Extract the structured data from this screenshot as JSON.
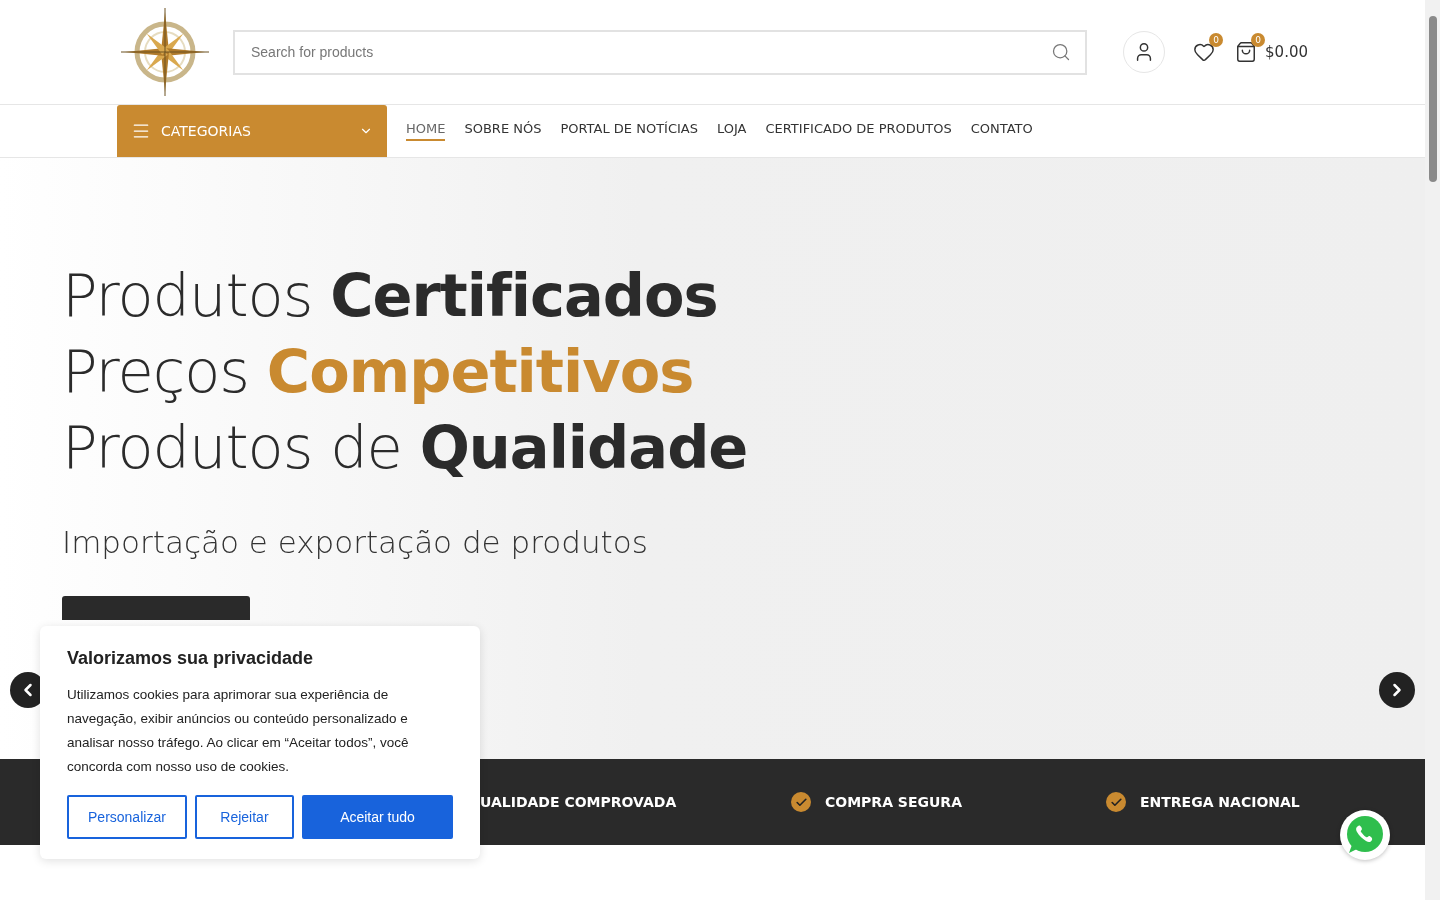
{
  "header": {
    "search": {
      "placeholder": "Search for products"
    },
    "wishlist_count": "0",
    "cart_count": "0",
    "cart_total": "$0.00"
  },
  "nav": {
    "categories": "CATEGORIAS",
    "items": [
      {
        "label": "HOME",
        "selected": true
      },
      {
        "label": "SOBRE NÓS",
        "selected": false
      },
      {
        "label": "PORTAL DE NOTÍCIAS",
        "selected": false
      },
      {
        "label": "LOJA",
        "selected": false
      },
      {
        "label": "CERTIFICADO DE PRODUTOS",
        "selected": false
      },
      {
        "label": "CONTATO",
        "selected": false
      }
    ]
  },
  "hero": {
    "lines": [
      [
        {
          "text": "Produtos ",
          "kind": "light"
        },
        {
          "text": "Certificados",
          "kind": "bold"
        }
      ],
      [
        {
          "text": "Preços ",
          "kind": "light"
        },
        {
          "text": "Competitivos",
          "kind": "accent"
        }
      ],
      [
        {
          "text": "Produtos de ",
          "kind": "light"
        },
        {
          "text": "Qualidade",
          "kind": "bold"
        }
      ]
    ],
    "subtitle": "Importação e exportação de produtos"
  },
  "features": [
    "UALIDADE COMPROVADA",
    "COMPRA SEGURA",
    "ENTREGA NACIONAL"
  ],
  "cookie_banner": {
    "title": "Valorizamos sua privacidade",
    "text": "Utilizamos cookies para aprimorar sua experiência de navegação, exibir anúncios ou conteúdo personalizado e analisar nosso tráfego. Ao clicar em “Aceitar todos”, você concorda com nosso uso de cookies.",
    "buttons": [
      {
        "label": "Personalizar",
        "kind": "outline"
      },
      {
        "label": "Rejeitar",
        "kind": "outline"
      },
      {
        "label": "Aceitar tudo",
        "kind": "primary"
      }
    ]
  }
}
